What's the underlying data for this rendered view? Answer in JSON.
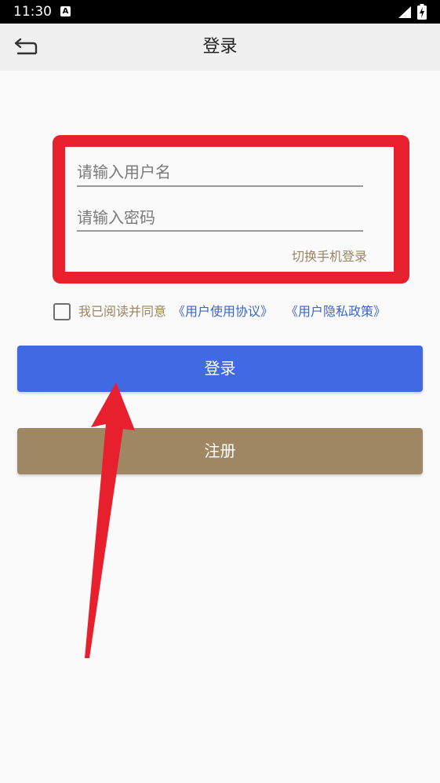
{
  "status_bar": {
    "time": "11:30",
    "notification_icon": "a-icon",
    "signal_icon": "signal-icon",
    "battery_icon": "battery-icon"
  },
  "header": {
    "back_icon": "back-icon",
    "title": "登录"
  },
  "form": {
    "username_placeholder": "请输入用户名",
    "username_value": "",
    "password_placeholder": "请输入密码",
    "password_value": "",
    "switch_link": "切换手机登录"
  },
  "agreement": {
    "checked": false,
    "text": "我已阅读并同意",
    "user_agreement": "《用户使用协议》",
    "privacy_policy": "《用户隐私政策》"
  },
  "buttons": {
    "login": "登录",
    "register": "注册"
  },
  "colors": {
    "accent_blue": "#4169e1",
    "accent_brown": "#a08763",
    "highlight_red": "#e8202e",
    "link_blue": "#3a66c9",
    "text_brown": "#9b8463"
  },
  "annotation": {
    "highlight_box": "red-rectangle",
    "arrow": "red-arrow-icon"
  }
}
